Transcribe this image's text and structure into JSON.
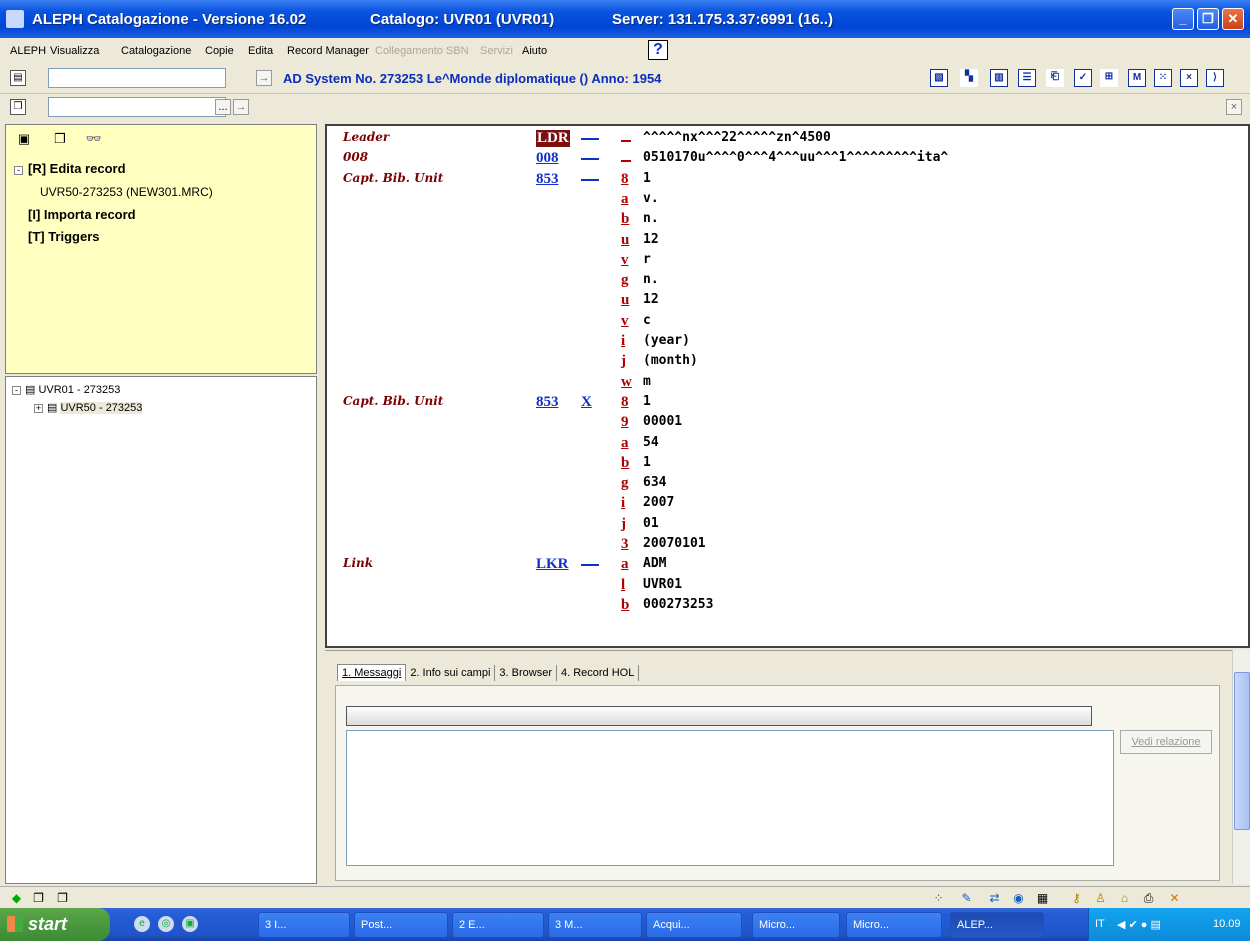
{
  "window": {
    "title": "ALEPH Catalogazione - Versione 16.02",
    "catalog": "Catalogo: UVR01 (UVR01)",
    "server": "Server: 131.175.3.37:6991 (16..)",
    "min": "_",
    "max": "❐",
    "close": "✕"
  },
  "menu": {
    "items": [
      "ALEPH",
      "Visualizza",
      "Catalogazione",
      "Copie",
      "Edita",
      "Record Manager"
    ],
    "disabled": [
      "Collegamento SBN",
      "Servizi"
    ],
    "help": "Aiuto",
    "help_icon": "?"
  },
  "toolbar": {
    "system_line": "AD System No. 273253 Le^Monde diplomatique () Anno: 1954",
    "search_value": "",
    "search2_value": "",
    "browse_label": "...",
    "go_label": "→"
  },
  "left_tabs": [
    "▣",
    "❒",
    "👓"
  ],
  "tree_top": {
    "items": [
      {
        "box": "-",
        "label": "[R] Edita record"
      },
      {
        "label": "UVR50-273253 (NEW301.MRC)"
      },
      {
        "label": "[I] Importa record"
      },
      {
        "label": "[T] Triggers"
      }
    ]
  },
  "tree_bottom": {
    "items": [
      {
        "box": "-",
        "label": "UVR01 - 273253"
      },
      {
        "box": "+",
        "label": "UVR50 - 273253"
      }
    ]
  },
  "record": {
    "fields": [
      {
        "name": "Leader",
        "tag": "LDR",
        "ind": "",
        "sub": "",
        "value": "^^^^^nx^^^22^^^^^zn^4500"
      },
      {
        "name": "008",
        "tag": "008",
        "ind": "",
        "sub": "",
        "value": "0510170u^^^^0^^^4^^^uu^^^1^^^^^^^^^ita^"
      },
      {
        "name": "Capt. Bib. Unit",
        "tag": "853",
        "ind": "",
        "sub": "8",
        "value": "1"
      },
      {
        "name": "",
        "tag": "",
        "ind": "",
        "sub": "a",
        "value": "v."
      },
      {
        "name": "",
        "tag": "",
        "ind": "",
        "sub": "b",
        "value": "n."
      },
      {
        "name": "",
        "tag": "",
        "ind": "",
        "sub": "u",
        "value": "12"
      },
      {
        "name": "",
        "tag": "",
        "ind": "",
        "sub": "v",
        "value": "r"
      },
      {
        "name": "",
        "tag": "",
        "ind": "",
        "sub": "g",
        "value": "n."
      },
      {
        "name": "",
        "tag": "",
        "ind": "",
        "sub": "u",
        "value": "12"
      },
      {
        "name": "",
        "tag": "",
        "ind": "",
        "sub": "v",
        "value": "c"
      },
      {
        "name": "",
        "tag": "",
        "ind": "",
        "sub": "i",
        "value": "(year)"
      },
      {
        "name": "",
        "tag": "",
        "ind": "",
        "sub": "j",
        "value": "(month)"
      },
      {
        "name": "",
        "tag": "",
        "ind": "",
        "sub": "w",
        "value": "m"
      },
      {
        "name": "Capt. Bib. Unit",
        "tag": "853",
        "ind": "X",
        "sub": "8",
        "value": "1"
      },
      {
        "name": "",
        "tag": "",
        "ind": "",
        "sub": "9",
        "value": "00001"
      },
      {
        "name": "",
        "tag": "",
        "ind": "",
        "sub": "a",
        "value": "54"
      },
      {
        "name": "",
        "tag": "",
        "ind": "",
        "sub": "b",
        "value": "1"
      },
      {
        "name": "",
        "tag": "",
        "ind": "",
        "sub": "g",
        "value": "634"
      },
      {
        "name": "",
        "tag": "",
        "ind": "",
        "sub": "i",
        "value": "2007"
      },
      {
        "name": "",
        "tag": "",
        "ind": "",
        "sub": "j",
        "value": "01"
      },
      {
        "name": "",
        "tag": "",
        "ind": "",
        "sub": "3",
        "value": "20070101"
      },
      {
        "name": "Link",
        "tag": "LKR",
        "ind": "",
        "sub": "a",
        "value": "ADM"
      },
      {
        "name": "",
        "tag": "",
        "ind": "",
        "sub": "l",
        "value": "UVR01"
      },
      {
        "name": "",
        "tag": "",
        "ind": "",
        "sub": "b",
        "value": "000273253"
      }
    ]
  },
  "lower": {
    "tabs": [
      "1. Messaggi",
      "2. Info sui campi",
      "3. Browser",
      "4. Record HOL"
    ],
    "vedi": "Vedi relazione"
  },
  "taskbar": {
    "start": "start",
    "buttons": [
      "3 I...",
      "Post...",
      "2 E...",
      "3 M...",
      "Acqui...",
      "Micro...",
      "Micro...",
      "ALEP..."
    ],
    "lang": "IT",
    "clock": "10.09"
  }
}
